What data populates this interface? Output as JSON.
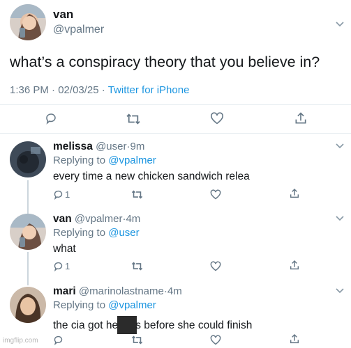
{
  "main_tweet": {
    "display_name": "van",
    "handle": "@vpalmer",
    "text": "what’s a conspiracy theory that you believe in?",
    "time": "1:36 PM",
    "date": "02/03/25",
    "source": "Twitter for iPhone"
  },
  "replies": [
    {
      "display_name": "melissa",
      "handle": "@user",
      "age": "9m",
      "replying_label": "Replying to",
      "replying_to": "@vpalmer",
      "text": "every time a new chicken sandwich relea",
      "reply_count": "1"
    },
    {
      "display_name": "van",
      "handle": "@vpalmer",
      "age": "4m",
      "replying_label": "Replying to",
      "replying_to": "@user",
      "text": "what",
      "reply_count": "1"
    },
    {
      "display_name": "mari",
      "handle": "@marinolastname",
      "age": "4m",
      "replying_label": "Replying to",
      "replying_to": "@vpalmer",
      "text_before": "the cia got her",
      "text_after": "s before she could finish"
    }
  ],
  "watermark": "imgflip.com",
  "icons": [
    "reply-icon",
    "retweet-icon",
    "like-icon",
    "share-icon",
    "chevron-down-icon"
  ],
  "colors": {
    "link": "#1b95e0",
    "muted": "#657786",
    "divider": "#e6ecf0"
  }
}
